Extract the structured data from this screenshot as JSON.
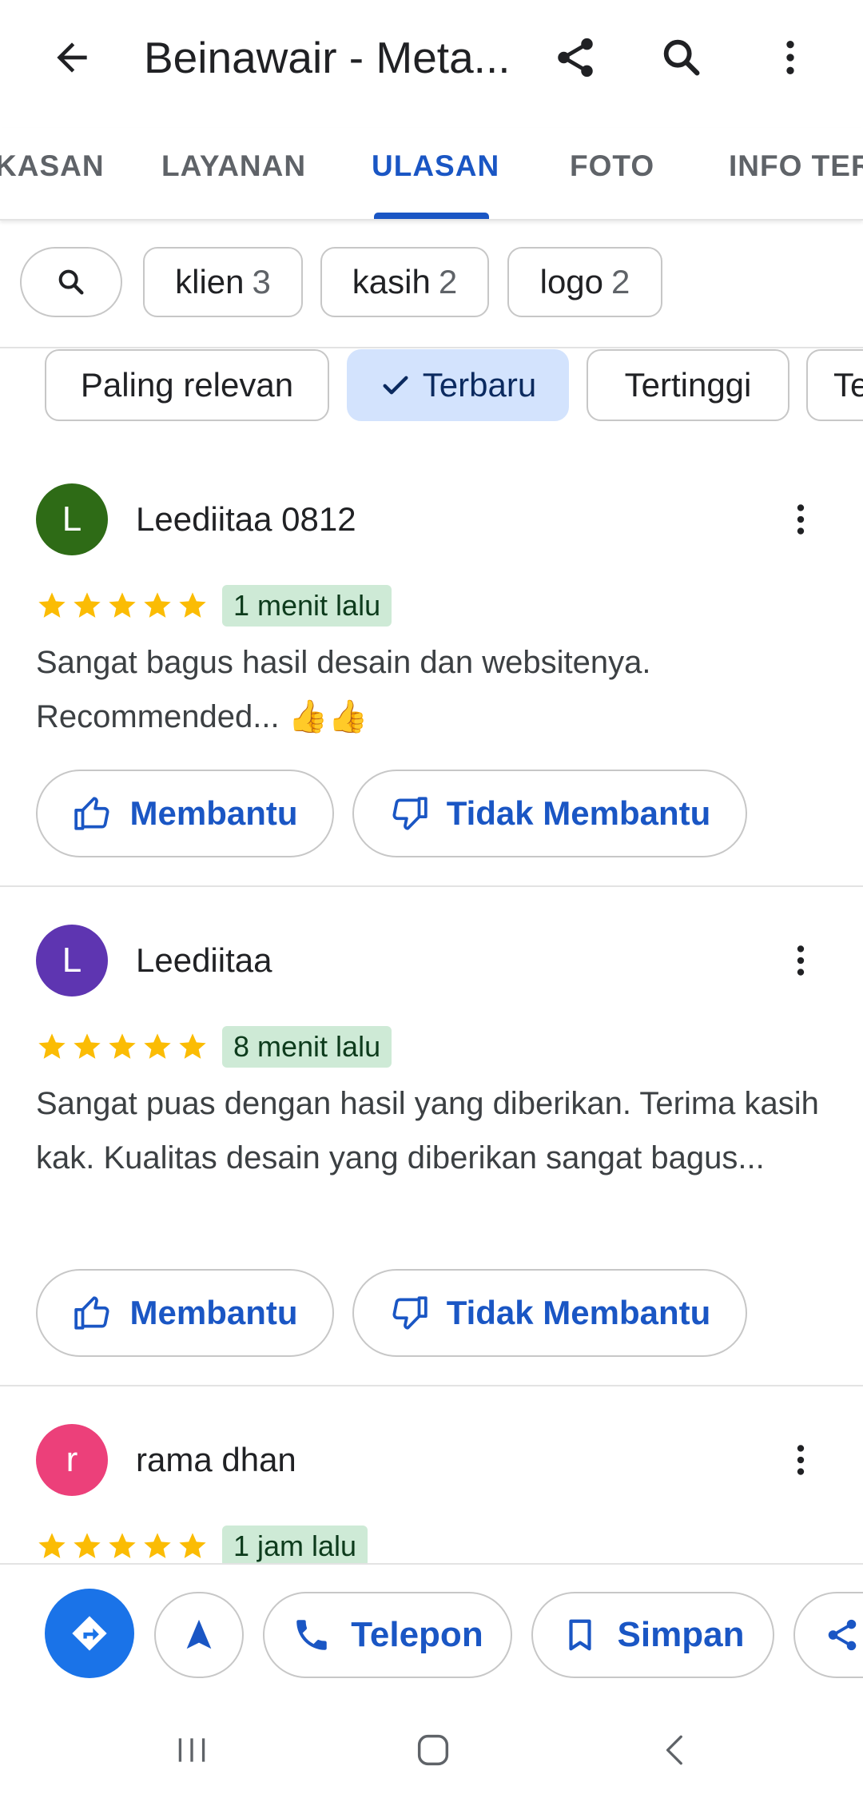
{
  "header": {
    "title": "Beinawair - Meta..."
  },
  "tabs": [
    {
      "label": "KASAN"
    },
    {
      "label": "LAYANAN"
    },
    {
      "label": "ULASAN"
    },
    {
      "label": "FOTO"
    },
    {
      "label": "INFO TER"
    }
  ],
  "active_tab": "ULASAN",
  "keywords": [
    {
      "word": "klien",
      "count": "3"
    },
    {
      "word": "kasih",
      "count": "2"
    },
    {
      "word": "logo",
      "count": "2"
    }
  ],
  "sort": {
    "options": [
      {
        "label": "Paling relevan"
      },
      {
        "label": "Terbaru"
      },
      {
        "label": "Tertinggi"
      },
      {
        "label": "Te"
      }
    ],
    "selected": "Terbaru"
  },
  "reviews": [
    {
      "initial": "L",
      "author": "Leediitaa 0812",
      "avatar_color": "#2e6b16",
      "rating": 5,
      "time": "1 menit lalu",
      "text": "Sangat bagus hasil desain dan websitenya. Recommended... 👍👍",
      "helpful_label": "Membantu",
      "not_helpful_label": "Tidak Membantu"
    },
    {
      "initial": "L",
      "author": "Leediitaa",
      "avatar_color": "#5e35b1",
      "rating": 5,
      "time": "8 menit lalu",
      "text": "Sangat puas dengan hasil yang diberikan. Terima kasih kak. Kualitas desain yang diberikan sangat bagus...",
      "helpful_label": "Membantu",
      "not_helpful_label": "Tidak Membantu"
    },
    {
      "initial": "r",
      "author": "rama dhan",
      "avatar_color": "#ec407a",
      "rating": 5,
      "time": "1 jam lalu"
    }
  ],
  "actions": {
    "call_label": "Telepon",
    "save_label": "Simpan"
  },
  "colors": {
    "accent": "#1a56c4",
    "fab": "#1a73e8",
    "star": "#fbbc04",
    "badge_bg": "#ceead6",
    "selected_chip_bg": "#d3e3fd"
  },
  "icons": {
    "back": "arrow-left-icon",
    "share": "share-icon",
    "search": "search-icon",
    "more": "more-vertical-icon",
    "directions": "directions-icon",
    "navigate": "navigation-arrow-icon",
    "phone": "phone-icon",
    "bookmark": "bookmark-icon"
  }
}
